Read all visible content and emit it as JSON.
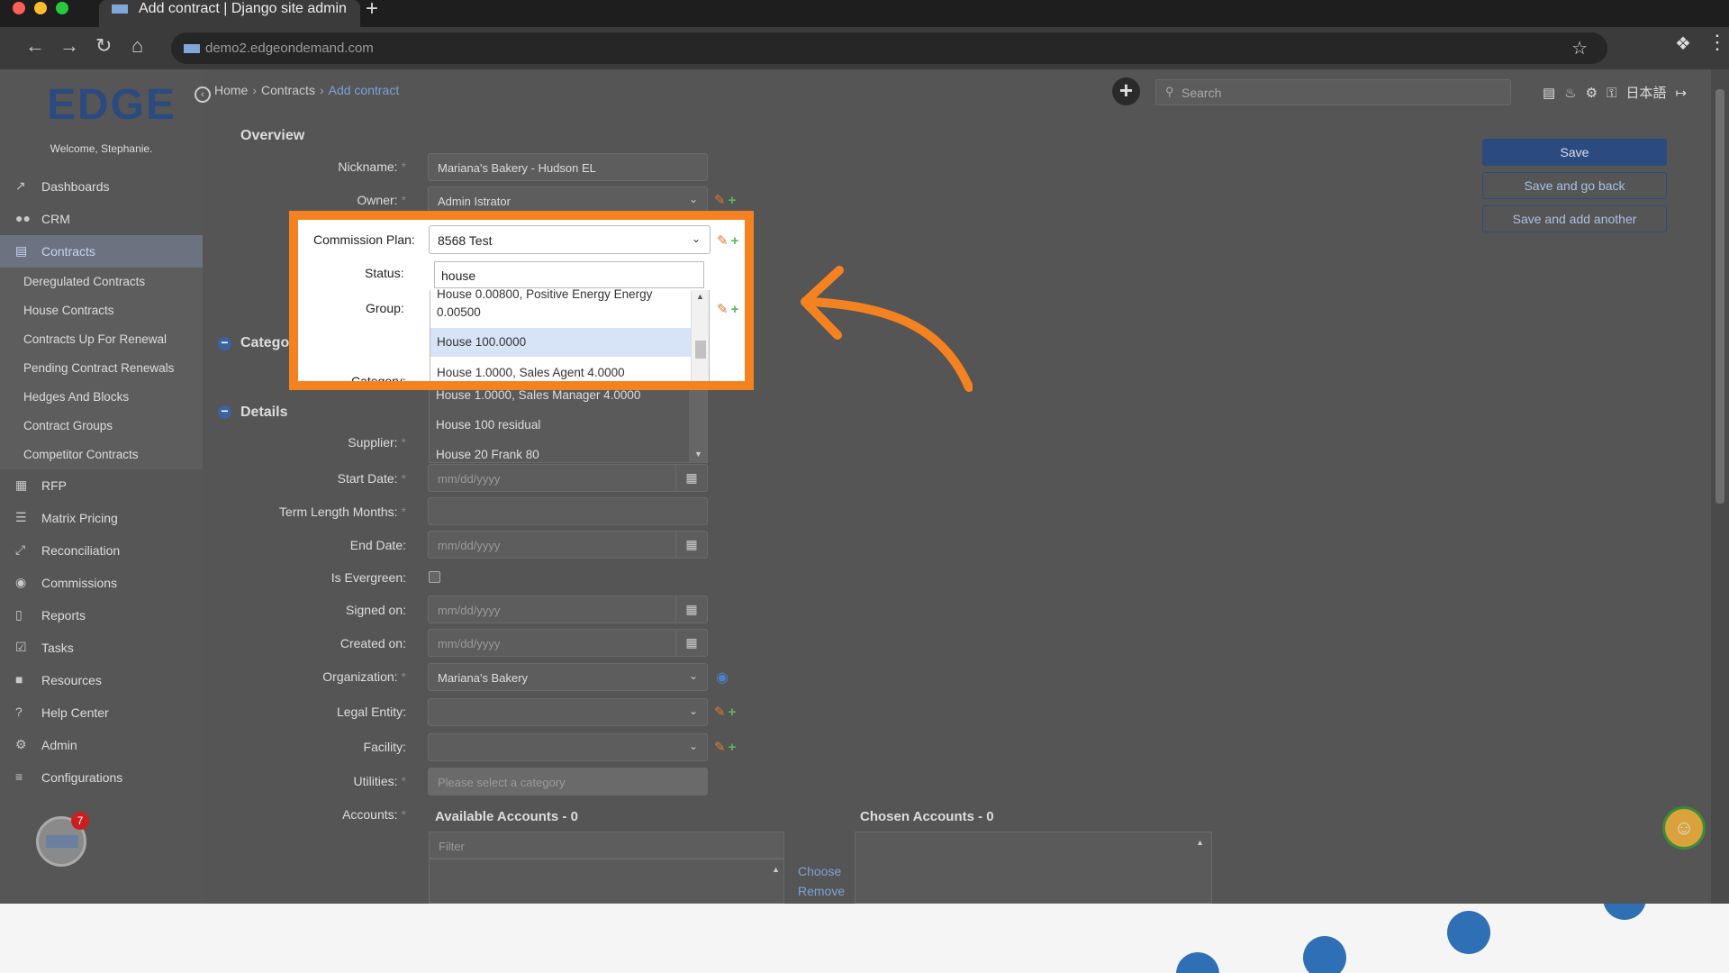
{
  "browser": {
    "tab_title": "Add contract | Django site admin",
    "url": "demo2.edgeondemand.com"
  },
  "sidebar": {
    "logo": "EDGE",
    "welcome": "Welcome, Stephanie.",
    "items": [
      {
        "label": "Dashboards",
        "icon": "chart-line-icon"
      },
      {
        "label": "CRM",
        "icon": "users-icon"
      },
      {
        "label": "Contracts",
        "icon": "file-icon",
        "active": true
      },
      {
        "label": "RFP",
        "icon": "sitemap-icon"
      },
      {
        "label": "Matrix Pricing",
        "icon": "list-icon"
      },
      {
        "label": "Reconciliation",
        "icon": "compress-icon"
      },
      {
        "label": "Commissions",
        "icon": "coins-icon"
      },
      {
        "label": "Reports",
        "icon": "bar-chart-icon"
      },
      {
        "label": "Tasks",
        "icon": "tasks-icon"
      },
      {
        "label": "Resources",
        "icon": "folder-icon"
      },
      {
        "label": "Help Center",
        "icon": "question-icon"
      },
      {
        "label": "Admin",
        "icon": "gears-icon"
      },
      {
        "label": "Configurations",
        "icon": "sliders-icon"
      }
    ],
    "contracts_sub": [
      "Deregulated Contracts",
      "House Contracts",
      "Contracts Up For Renewal",
      "Pending Contract Renewals",
      "Hedges And Blocks",
      "Contract Groups",
      "Competitor Contracts"
    ],
    "badge_count": "7"
  },
  "breadcrumb": {
    "home": "Home",
    "contracts": "Contracts",
    "current": "Add contract"
  },
  "search": {
    "placeholder": "Search"
  },
  "header": {
    "language": "日本語"
  },
  "form": {
    "overview_title": "Overview",
    "category_title": "Categor",
    "details_title": "Details",
    "nickname_label": "Nickname:",
    "nickname_value": "Mariana's Bakery - Hudson EL",
    "owner_label": "Owner:",
    "owner_value": "Admin Istrator",
    "commission_label": "Commission Plan:",
    "commission_value": "8568 Test",
    "status_label": "Status:",
    "group_label": "Group:",
    "category_label": "Category:",
    "search_value": "house",
    "supplier_label": "Supplier:",
    "start_label": "Start Date:",
    "term_label": "Term Length Months:",
    "end_label": "End Date:",
    "evergreen_label": "Is Evergreen:",
    "signed_label": "Signed on:",
    "created_label": "Created on:",
    "org_label": "Organization:",
    "org_value": "Mariana's Bakery",
    "legal_label": "Legal Entity:",
    "facility_label": "Facility:",
    "utilities_label": "Utilities:",
    "utilities_placeholder": "Please select a category",
    "accounts_label": "Accounts:",
    "date_placeholder": "mm/dd/yyyy",
    "required_mark": "*"
  },
  "dropdown": {
    "options": [
      "House 0.00800, Positive Energy Energy",
      "0.00500",
      "House 100.0000",
      "House 1.0000, Sales Agent 4.0000",
      "House 1.0000, Sales Manager 4.0000",
      "House 100 residual",
      "House 20 Frank 80"
    ],
    "selected": "House 100.0000"
  },
  "buttons": {
    "save": "Save",
    "save_back": "Save and go back",
    "save_add": "Save and add another"
  },
  "accounts": {
    "available": "Available Accounts - 0",
    "chosen": "Chosen Accounts - 0",
    "filter_placeholder": "Filter",
    "choose": "Choose",
    "remove": "Remove"
  },
  "colors": {
    "highlight": "#f58220",
    "brand": "#2b4b80"
  }
}
